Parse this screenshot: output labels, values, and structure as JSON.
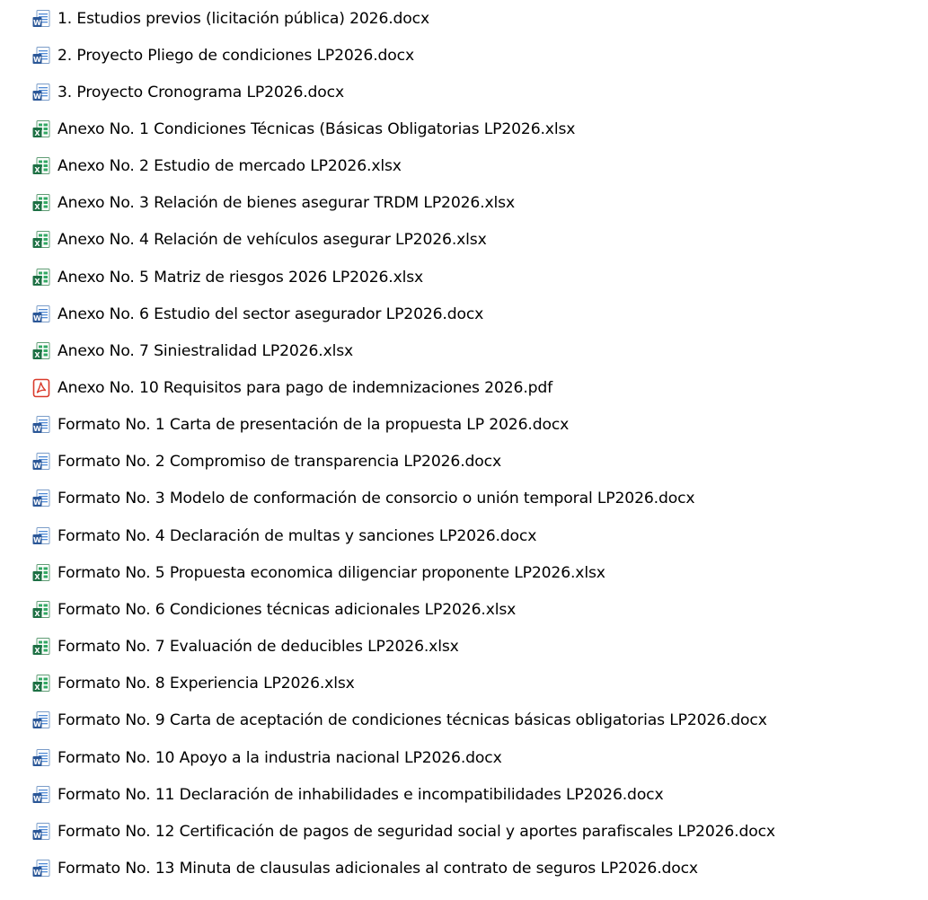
{
  "files": [
    {
      "name": "1. Estudios previos (licitación pública) 2026.docx",
      "icon": "word-document-icon"
    },
    {
      "name": "2. Proyecto Pliego de condiciones LP2026.docx",
      "icon": "word-document-icon"
    },
    {
      "name": "3. Proyecto Cronograma LP2026.docx",
      "icon": "word-document-icon"
    },
    {
      "name": "Anexo No. 1 Condiciones Técnicas (Básicas Obligatorias LP2026.xlsx",
      "icon": "excel-spreadsheet-icon"
    },
    {
      "name": "Anexo No. 2 Estudio de mercado LP2026.xlsx",
      "icon": "excel-spreadsheet-icon"
    },
    {
      "name": "Anexo No. 3 Relación de bienes asegurar TRDM LP2026.xlsx",
      "icon": "excel-spreadsheet-icon"
    },
    {
      "name": "Anexo No. 4 Relación de vehículos asegurar LP2026.xlsx",
      "icon": "excel-spreadsheet-icon"
    },
    {
      "name": "Anexo No. 5 Matriz de riesgos 2026 LP2026.xlsx",
      "icon": "excel-spreadsheet-icon"
    },
    {
      "name": "Anexo No. 6  Estudio del sector asegurador LP2026.docx",
      "icon": "word-document-icon"
    },
    {
      "name": "Anexo No. 7 Siniestralidad LP2026.xlsx",
      "icon": "excel-spreadsheet-icon"
    },
    {
      "name": "Anexo No. 10 Requisitos para pago de indemnizaciones 2026.pdf",
      "icon": "pdf-document-icon"
    },
    {
      "name": "Formato No. 1 Carta de presentación de la propuesta LP 2026.docx",
      "icon": "word-document-icon"
    },
    {
      "name": "Formato No. 2 Compromiso de transparencia LP2026.docx",
      "icon": "word-document-icon"
    },
    {
      "name": "Formato No. 3 Modelo de conformación de consorcio o unión temporal LP2026.docx",
      "icon": "word-document-icon"
    },
    {
      "name": "Formato No. 4 Declaración de multas y sanciones LP2026.docx",
      "icon": "word-document-icon"
    },
    {
      "name": "Formato No. 5 Propuesta economica diligenciar proponente LP2026.xlsx",
      "icon": "excel-spreadsheet-icon"
    },
    {
      "name": "Formato No. 6 Condiciones técnicas adicionales LP2026.xlsx",
      "icon": "excel-spreadsheet-icon"
    },
    {
      "name": "Formato No. 7 Evaluación de deducibles LP2026.xlsx",
      "icon": "excel-spreadsheet-icon"
    },
    {
      "name": "Formato No. 8 Experiencia LP2026.xlsx",
      "icon": "excel-spreadsheet-icon"
    },
    {
      "name": "Formato No. 9 Carta de aceptación de condiciones técnicas básicas obligatorias LP2026.docx",
      "icon": "word-document-icon"
    },
    {
      "name": "Formato No. 10 Apoyo a la industria nacional LP2026.docx",
      "icon": "word-document-icon"
    },
    {
      "name": "Formato No. 11 Declaración de inhabilidades e incompatibilidades LP2026.docx",
      "icon": "word-document-icon"
    },
    {
      "name": "Formato No. 12 Certificación de pagos de seguridad social y aportes parafiscales LP2026.docx",
      "icon": "word-document-icon"
    },
    {
      "name": "Formato No. 13 Minuta de clausulas adicionales al contrato de seguros LP2026.docx",
      "icon": "word-document-icon"
    }
  ],
  "colors": {
    "word_blue": "#2b5797",
    "word_light": "#4f8ad6",
    "excel_green": "#1d7044",
    "excel_light": "#33a864",
    "pdf_red": "#d93a2b",
    "text": "#000000"
  }
}
